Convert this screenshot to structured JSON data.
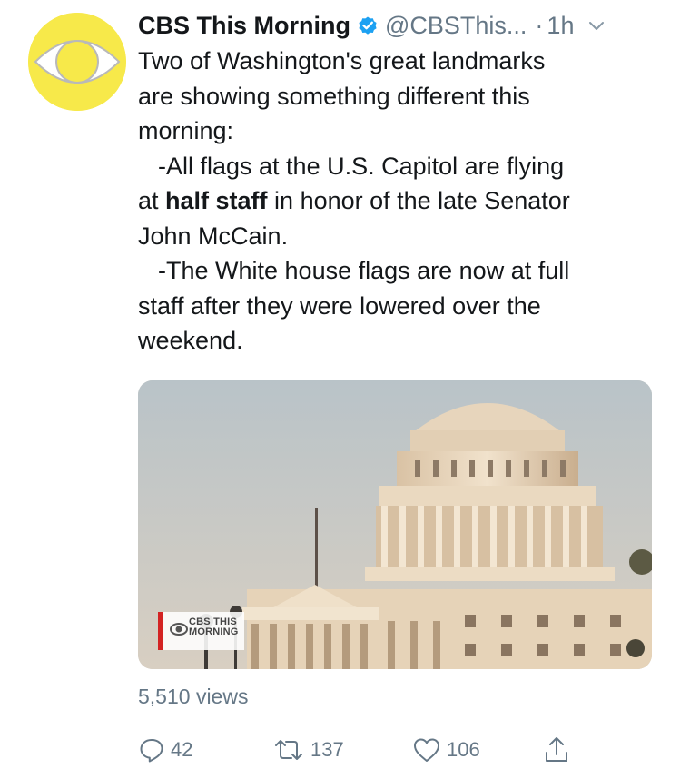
{
  "tweet": {
    "display_name": "CBS This Morning",
    "handle": "@CBSThis...",
    "separator": "·",
    "time": "1h",
    "text_lines": [
      "Two of Washington's great landmarks",
      "are showing something different this",
      "morning:",
      "-All flags at the U.S. Capitol are flying",
      "at ",
      "half staff",
      " in honor of the late Senator",
      "John McCain.",
      "-The White house flags are now at full",
      "staff after they were lowered over the",
      "weekend."
    ],
    "views": "5,510 views"
  },
  "video": {
    "watermark_line1": "CBS THIS",
    "watermark_line2": "MORNING"
  },
  "actions": {
    "reply_count": "42",
    "retweet_count": "137",
    "like_count": "106"
  },
  "colors": {
    "verified_blue": "#1da1f2",
    "muted_gray": "#657786",
    "text": "#14171a",
    "avatar_yellow": "#f7e94a"
  },
  "icons": {
    "verified": "verified-badge-icon",
    "caret": "chevron-down-icon",
    "reply": "reply-icon",
    "retweet": "retweet-icon",
    "like": "heart-icon",
    "share": "share-icon"
  }
}
